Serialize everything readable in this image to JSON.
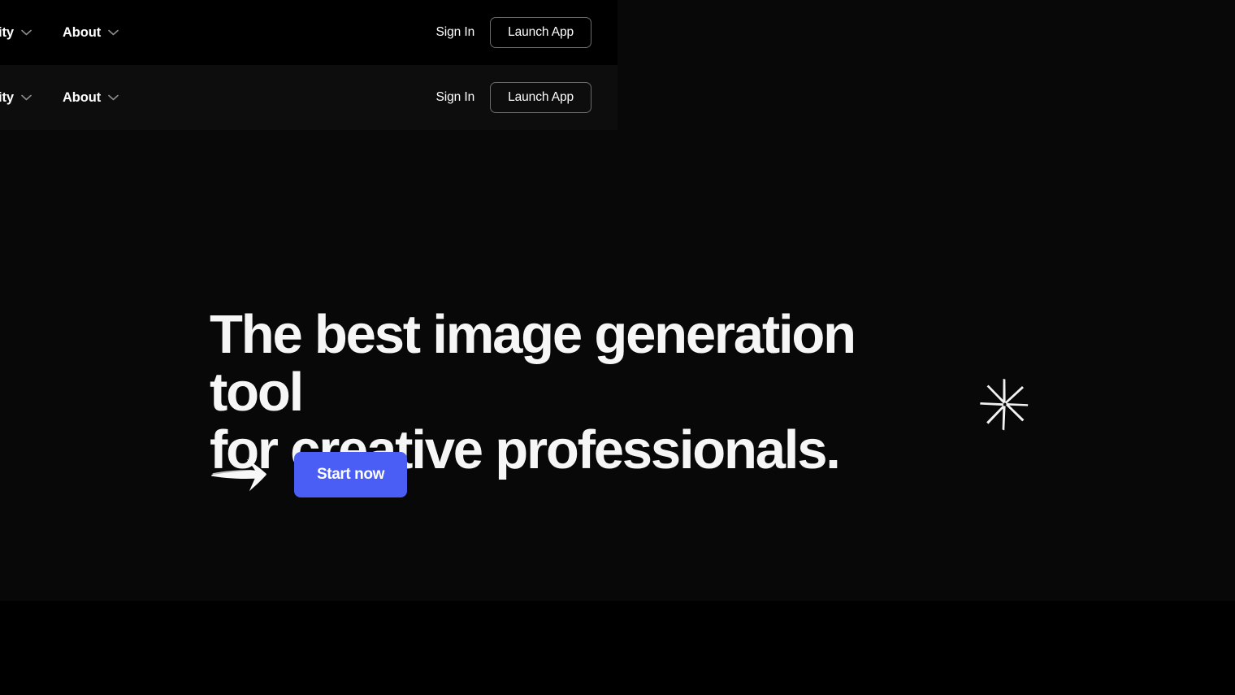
{
  "theme": {
    "page_background": "#000000",
    "hero_background": "#080808",
    "navbar_primary_background": "#000000",
    "navbar_secondary_background": "#0d0d0d",
    "accent_blue": "#4a5ef5",
    "text_primary": "#ffffff",
    "headline_color": "#f6f6f6",
    "chevron_color": "#8d8d8d",
    "outline_border": "#6a6a6a"
  },
  "navbars": [
    {
      "id": "navbar-primary",
      "links": [
        {
          "label": "nity",
          "icon": "chevron-down-icon",
          "has_dropdown": true
        },
        {
          "label": "About",
          "icon": "chevron-down-icon",
          "has_dropdown": true
        }
      ],
      "sign_in_label": "Sign In",
      "launch_app_label": "Launch App"
    },
    {
      "id": "navbar-secondary",
      "links": [
        {
          "label": "nity",
          "icon": "chevron-down-icon",
          "has_dropdown": true
        },
        {
          "label": "About",
          "icon": "chevron-down-icon",
          "has_dropdown": true
        }
      ],
      "sign_in_label": "Sign In",
      "launch_app_label": "Launch App"
    }
  ],
  "hero": {
    "headline": "The best image generation tool\nfor creative professionals.",
    "cta_label": "Start now",
    "arrow_icon": "hand-drawn-arrow-right-icon",
    "sparkle_icon": "hand-drawn-sparkle-star-icon"
  }
}
